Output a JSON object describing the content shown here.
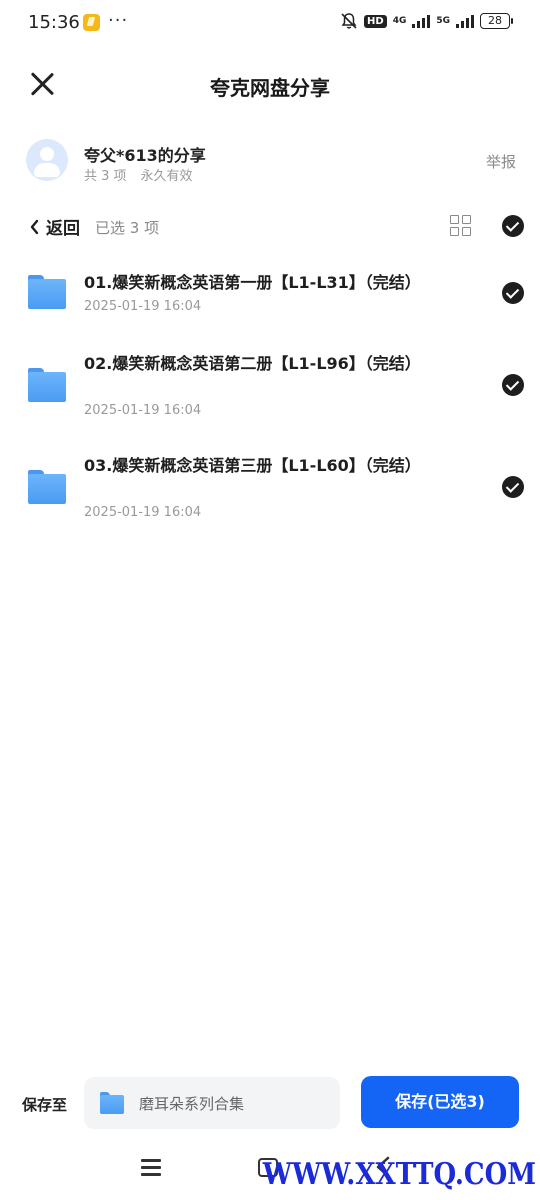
{
  "status_bar": {
    "time": "15:36",
    "more": "···",
    "hd_badge": "HD",
    "network_1": "4G",
    "network_2": "5G",
    "battery": "28"
  },
  "header": {
    "title": "夸克网盘分享"
  },
  "sharer": {
    "name": "夸父*613的分享",
    "item_count": "共 3 项",
    "validity": "永久有效",
    "report_label": "举报"
  },
  "toolbar": {
    "back_label": "返回",
    "selected_text": "已选 3 项"
  },
  "files": [
    {
      "name": "01.爆笑新概念英语第一册【L1-L31】（完结）",
      "date": "2025-01-19 16:04"
    },
    {
      "name": "02.爆笑新概念英语第二册【L1-L96】（完结）",
      "date": "2025-01-19 16:04"
    },
    {
      "name": "03.爆笑新概念英语第三册【L1-L60】（完结）",
      "date": "2025-01-19 16:04"
    }
  ],
  "bottom": {
    "save_to_label": "保存至",
    "destination": "磨耳朵系列合集",
    "save_button": "保存(已选3)"
  },
  "watermark": "WWW.XXTTQ.COM",
  "colors": {
    "accent": "#1464f6",
    "folder": "#5aa6f6",
    "check": "#1e1e1e",
    "muted_text": "#9a9a9a"
  }
}
